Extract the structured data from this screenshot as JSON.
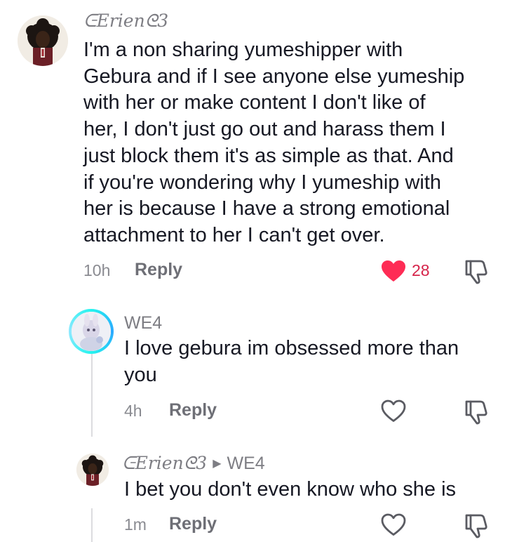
{
  "comments": [
    {
      "username": "ᕮErienᘓ3",
      "text_lines": [
        "I'm a non sharing yumeshipper with",
        "Gebura and if I see anyone else yumeship",
        "with her or make content I don't like of",
        "her, I don't just go out and harass them I",
        "just block them it's as simple as that. And",
        "if you're wondering why I yumeship with",
        "her is because I have a strong emotional",
        "attachment to her I can't get over."
      ],
      "time": "10h",
      "reply_label": "Reply",
      "like_count": "28",
      "liked": true
    },
    {
      "username": "WE4",
      "text_lines": [
        "I love gebura im obsessed more than",
        "you"
      ],
      "time": "4h",
      "reply_label": "Reply",
      "liked": false
    },
    {
      "username": "ᕮErienᘓ3",
      "reply_to": "WE4",
      "text_lines": [
        "I bet you don't even know who she is"
      ],
      "time": "1m",
      "reply_label": "Reply",
      "liked": false
    }
  ],
  "colors": {
    "text": "#161823",
    "secondary": "#8a8b91",
    "like_active": "#fe2c55",
    "like_count": "#d6244a"
  },
  "icons": [
    "heart-icon",
    "dislike-icon",
    "avatar"
  ]
}
